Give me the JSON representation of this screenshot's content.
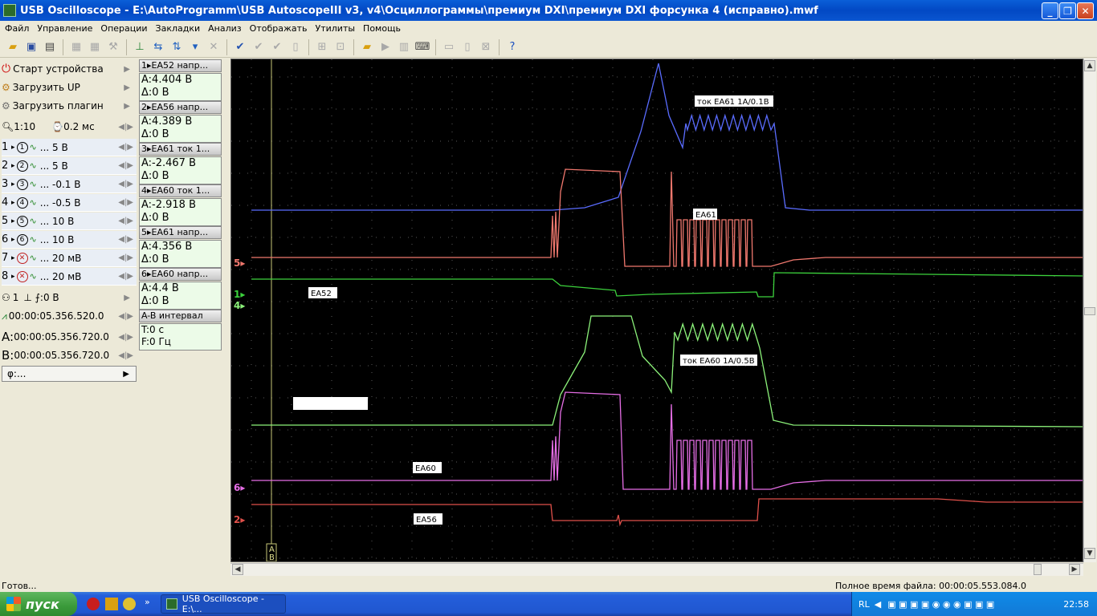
{
  "window": {
    "title": "USB Oscilloscope - E:\\AutoProgramm\\USB AutoscopeIII v3, v4\\Осциллограммы\\премиум DXI\\премиум DXI форсунка 4 (исправно).mwf"
  },
  "menu": [
    "Файл",
    "Управление",
    "Операции",
    "Закладки",
    "Анализ",
    "Отображать",
    "Утилиты",
    "Помощь"
  ],
  "left_panel": {
    "start_device": "Старт устройства",
    "load_up": "Загрузить UP",
    "load_plugin": "Загрузить плагин",
    "zoom": "1:10",
    "timebase": "0.2 мс",
    "channels": [
      {
        "num": "1",
        "scale": "... 5 В",
        "enabled": true
      },
      {
        "num": "2",
        "scale": "... 5 В",
        "enabled": true
      },
      {
        "num": "3",
        "scale": "... -0.1 В",
        "enabled": true
      },
      {
        "num": "4",
        "scale": "... -0.5 В",
        "enabled": true
      },
      {
        "num": "5",
        "scale": "... 10 В",
        "enabled": true
      },
      {
        "num": "6",
        "scale": "... 10 В",
        "enabled": true
      },
      {
        "num": "7",
        "scale": "... 20 мВ",
        "enabled": false
      },
      {
        "num": "8",
        "scale": "... 20 мВ",
        "enabled": false
      }
    ],
    "trigger": {
      "channel": "1",
      "level": "0 В"
    },
    "trigger_time": "00:00:05.356.520.0",
    "cursor_a": "00:00:05.356.720.0",
    "cursor_b": "00:00:05.356.720.0",
    "cursor_a_label": "A:",
    "cursor_b_label": "B:",
    "phi": "φ:..."
  },
  "measurements": [
    {
      "header": "1▸EA52 напр...",
      "a": "A:4.404 В",
      "d": "Δ:0 В"
    },
    {
      "header": "2▸EA56 напр...",
      "a": "A:4.389 В",
      "d": "Δ:0 В"
    },
    {
      "header": "3▸EA61 ток 1...",
      "a": "A:-2.467 В",
      "d": "Δ:0 В"
    },
    {
      "header": "4▸EA60 ток 1...",
      "a": "A:-2.918 В",
      "d": "Δ:0 В"
    },
    {
      "header": "5▸EA61 напр...",
      "a": "A:4.356 В",
      "d": "Δ:0 В"
    },
    {
      "header": "6▸EA60 напр...",
      "a": "A:4.4 В",
      "d": "Δ:0 В"
    }
  ],
  "interval": {
    "header": "A-B интервал",
    "t": "T:0 с",
    "f": "F:0 Гц"
  },
  "scope": {
    "labels": {
      "tok_ea61": "ток EA61 1A/0.1В",
      "ea61": "EA61",
      "ea52": "EA52",
      "tok_ea60": "ток EA60 1A/0.5В",
      "ea60": "EA60",
      "ea56": "EA56"
    },
    "channel_markers": {
      "ch5": "5▸",
      "ch1": "1▸",
      "ch4": "4▸",
      "ch6": "6▸",
      "ch2": "2▸"
    },
    "cursor_tag_a": "A",
    "cursor_tag_b": "B",
    "colors": {
      "ch1": "#3cd23c",
      "ch2": "#e0504a",
      "ch3": "#5a6cff",
      "ch4": "#8cf27a",
      "ch5": "#f0786e",
      "ch6": "#e66ee6",
      "grid": "#5a5a5a"
    }
  },
  "status": {
    "left": "Готов...",
    "right": "Полное время файла: 00:00:05.553.084.0"
  },
  "taskbar": {
    "start": "пуск",
    "task": "USB Oscilloscope - E:\\...",
    "lang": "RL",
    "clock": "22:58"
  }
}
